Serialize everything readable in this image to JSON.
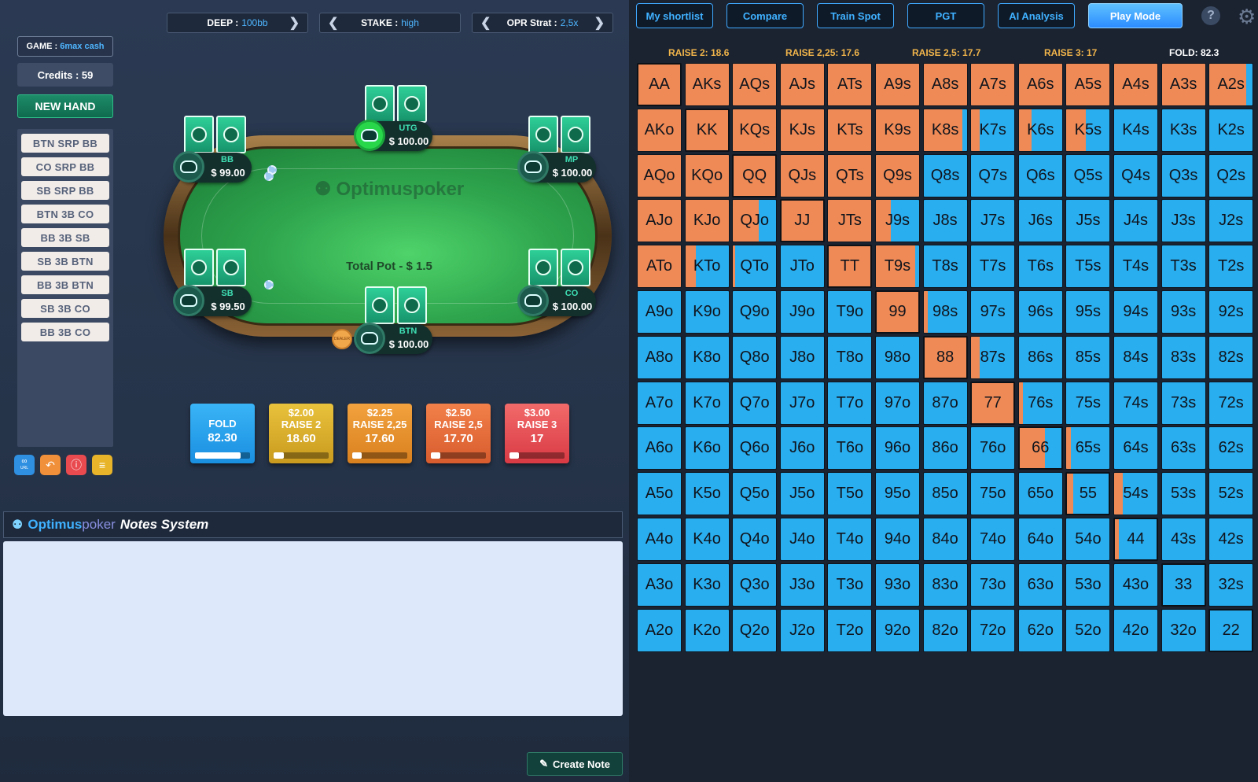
{
  "selectors": [
    {
      "key": "DEEP :",
      "value": "100bb"
    },
    {
      "key": "STAKE :",
      "value": "high"
    },
    {
      "key": "OPR Strat :",
      "value": "2,5x"
    }
  ],
  "game": {
    "key": "GAME :",
    "value": "6max cash"
  },
  "credits": "Credits : 59",
  "new_hand": "NEW HAND",
  "spots": [
    "BTN SRP BB",
    "CO SRP BB",
    "SB SRP BB",
    "BTN 3B CO",
    "BB 3B SB",
    "SB 3B BTN",
    "BB 3B BTN",
    "SB 3B CO",
    "BB 3B CO"
  ],
  "tool_icons": [
    "link-url-icon",
    "undo-icon",
    "alert-icon",
    "notes-icon"
  ],
  "tool_label_url": "URL",
  "table": {
    "logo": "Optimuspoker",
    "pot": "Total Pot - $ 1.5",
    "dealer": "DEALER",
    "seats": {
      "utg": {
        "name": "UTG",
        "stack": "$ 100.00"
      },
      "bb": {
        "name": "BB",
        "stack": "$ 99.00"
      },
      "mp": {
        "name": "MP",
        "stack": "$ 100.00"
      },
      "sb": {
        "name": "SB",
        "stack": "$ 99.50"
      },
      "co": {
        "name": "CO",
        "stack": "$ 100.00"
      },
      "btn": {
        "name": "BTN",
        "stack": "$ 100.00"
      }
    }
  },
  "actions": [
    {
      "amount": "",
      "name": "FOLD",
      "freq": "82.30",
      "pct": 82.3,
      "color": "#1e9ef0"
    },
    {
      "amount": "$2.00",
      "name": "RAISE 2",
      "freq": "18.60",
      "pct": 18.6,
      "color": "#d9ac2a"
    },
    {
      "amount": "$2.25",
      "name": "RAISE 2,25",
      "freq": "17.60",
      "pct": 17.6,
      "color": "#e88f2e"
    },
    {
      "amount": "$2.50",
      "name": "RAISE 2,5",
      "freq": "17.70",
      "pct": 17.7,
      "color": "#e8683a"
    },
    {
      "amount": "$3.00",
      "name": "RAISE 3",
      "freq": "17",
      "pct": 17,
      "color": "#ea4f52"
    }
  ],
  "notes": {
    "brand1": "Optimus",
    "brand2": "poker",
    "title": "Notes System",
    "create": "Create Note"
  },
  "nav": [
    "My shortlist",
    "Compare",
    "Train Spot",
    "PGT",
    "AI Analysis",
    "Play Mode"
  ],
  "nav_active": "Play Mode",
  "help": "?",
  "freq_labels": [
    "RAISE 2: 18.6",
    "RAISE 2,25: 17.6",
    "RAISE 2,5: 17.7",
    "RAISE 3: 17",
    "FOLD: 82.3"
  ],
  "colors": {
    "raise": "#ef8a56",
    "fold": "#29aef0"
  },
  "range_grid": [
    [
      [
        "AA",
        1
      ],
      [
        "AKs",
        1
      ],
      [
        "AQs",
        1
      ],
      [
        "AJs",
        1
      ],
      [
        "ATs",
        1
      ],
      [
        "A9s",
        1
      ],
      [
        "A8s",
        1
      ],
      [
        "A7s",
        1
      ],
      [
        "A6s",
        1
      ],
      [
        "A5s",
        1
      ],
      [
        "A4s",
        1
      ],
      [
        "A3s",
        1
      ],
      [
        "A2s",
        0.85
      ]
    ],
    [
      [
        "AKo",
        1
      ],
      [
        "KK",
        1
      ],
      [
        "KQs",
        1
      ],
      [
        "KJs",
        1
      ],
      [
        "KTs",
        1
      ],
      [
        "K9s",
        1
      ],
      [
        "K8s",
        0.9
      ],
      [
        "K7s",
        0.2
      ],
      [
        "K6s",
        0.3
      ],
      [
        "K5s",
        0.45
      ],
      [
        "K4s",
        0
      ],
      [
        "K3s",
        0
      ],
      [
        "K2s",
        0
      ]
    ],
    [
      [
        "AQo",
        1
      ],
      [
        "KQo",
        1
      ],
      [
        "QQ",
        1
      ],
      [
        "QJs",
        1
      ],
      [
        "QTs",
        1
      ],
      [
        "Q9s",
        1
      ],
      [
        "Q8s",
        0
      ],
      [
        "Q7s",
        0
      ],
      [
        "Q6s",
        0
      ],
      [
        "Q5s",
        0
      ],
      [
        "Q4s",
        0
      ],
      [
        "Q3s",
        0
      ],
      [
        "Q2s",
        0
      ]
    ],
    [
      [
        "AJo",
        1
      ],
      [
        "KJo",
        1
      ],
      [
        "QJo",
        0.6
      ],
      [
        "JJ",
        1
      ],
      [
        "JTs",
        1
      ],
      [
        "J9s",
        0.35
      ],
      [
        "J8s",
        0
      ],
      [
        "J7s",
        0
      ],
      [
        "J6s",
        0
      ],
      [
        "J5s",
        0
      ],
      [
        "J4s",
        0
      ],
      [
        "J3s",
        0
      ],
      [
        "J2s",
        0
      ]
    ],
    [
      [
        "ATo",
        1
      ],
      [
        "KTo",
        0.25
      ],
      [
        "QTo",
        0.05
      ],
      [
        "JTo",
        0
      ],
      [
        "TT",
        1
      ],
      [
        "T9s",
        0.9
      ],
      [
        "T8s",
        0
      ],
      [
        "T7s",
        0
      ],
      [
        "T6s",
        0
      ],
      [
        "T5s",
        0
      ],
      [
        "T4s",
        0
      ],
      [
        "T3s",
        0
      ],
      [
        "T2s",
        0
      ]
    ],
    [
      [
        "A9o",
        0
      ],
      [
        "K9o",
        0
      ],
      [
        "Q9o",
        0
      ],
      [
        "J9o",
        0
      ],
      [
        "T9o",
        0
      ],
      [
        "99",
        1
      ],
      [
        "98s",
        0.1
      ],
      [
        "97s",
        0
      ],
      [
        "96s",
        0
      ],
      [
        "95s",
        0
      ],
      [
        "94s",
        0
      ],
      [
        "93s",
        0
      ],
      [
        "92s",
        0
      ]
    ],
    [
      [
        "A8o",
        0
      ],
      [
        "K8o",
        0
      ],
      [
        "Q8o",
        0
      ],
      [
        "J8o",
        0
      ],
      [
        "T8o",
        0
      ],
      [
        "98o",
        0
      ],
      [
        "88",
        1
      ],
      [
        "87s",
        0.2
      ],
      [
        "86s",
        0
      ],
      [
        "85s",
        0
      ],
      [
        "84s",
        0
      ],
      [
        "83s",
        0
      ],
      [
        "82s",
        0
      ]
    ],
    [
      [
        "A7o",
        0
      ],
      [
        "K7o",
        0
      ],
      [
        "Q7o",
        0
      ],
      [
        "J7o",
        0
      ],
      [
        "T7o",
        0
      ],
      [
        "97o",
        0
      ],
      [
        "87o",
        0
      ],
      [
        "77",
        1
      ],
      [
        "76s",
        0.1
      ],
      [
        "75s",
        0
      ],
      [
        "74s",
        0
      ],
      [
        "73s",
        0
      ],
      [
        "72s",
        0
      ]
    ],
    [
      [
        "A6o",
        0
      ],
      [
        "K6o",
        0
      ],
      [
        "Q6o",
        0
      ],
      [
        "J6o",
        0
      ],
      [
        "T6o",
        0
      ],
      [
        "96o",
        0
      ],
      [
        "86o",
        0
      ],
      [
        "76o",
        0
      ],
      [
        "66",
        0.6
      ],
      [
        "65s",
        0.1
      ],
      [
        "64s",
        0
      ],
      [
        "63s",
        0
      ],
      [
        "62s",
        0
      ]
    ],
    [
      [
        "A5o",
        0
      ],
      [
        "K5o",
        0
      ],
      [
        "Q5o",
        0
      ],
      [
        "J5o",
        0
      ],
      [
        "T5o",
        0
      ],
      [
        "95o",
        0
      ],
      [
        "85o",
        0
      ],
      [
        "75o",
        0
      ],
      [
        "65o",
        0
      ],
      [
        "55",
        0.15
      ],
      [
        "54s",
        0.2
      ],
      [
        "53s",
        0
      ],
      [
        "52s",
        0
      ]
    ],
    [
      [
        "A4o",
        0
      ],
      [
        "K4o",
        0
      ],
      [
        "Q4o",
        0
      ],
      [
        "J4o",
        0
      ],
      [
        "T4o",
        0
      ],
      [
        "94o",
        0
      ],
      [
        "84o",
        0
      ],
      [
        "74o",
        0
      ],
      [
        "64o",
        0
      ],
      [
        "54o",
        0
      ],
      [
        "44",
        0.1
      ],
      [
        "43s",
        0
      ],
      [
        "42s",
        0
      ]
    ],
    [
      [
        "A3o",
        0
      ],
      [
        "K3o",
        0
      ],
      [
        "Q3o",
        0
      ],
      [
        "J3o",
        0
      ],
      [
        "T3o",
        0
      ],
      [
        "93o",
        0
      ],
      [
        "83o",
        0
      ],
      [
        "73o",
        0
      ],
      [
        "63o",
        0
      ],
      [
        "53o",
        0
      ],
      [
        "43o",
        0
      ],
      [
        "33",
        0
      ],
      [
        "32s",
        0
      ]
    ],
    [
      [
        "A2o",
        0
      ],
      [
        "K2o",
        0
      ],
      [
        "Q2o",
        0
      ],
      [
        "J2o",
        0
      ],
      [
        "T2o",
        0
      ],
      [
        "92o",
        0
      ],
      [
        "82o",
        0
      ],
      [
        "72o",
        0
      ],
      [
        "62o",
        0
      ],
      [
        "52o",
        0
      ],
      [
        "42o",
        0
      ],
      [
        "32o",
        0
      ],
      [
        "22",
        0
      ]
    ]
  ]
}
